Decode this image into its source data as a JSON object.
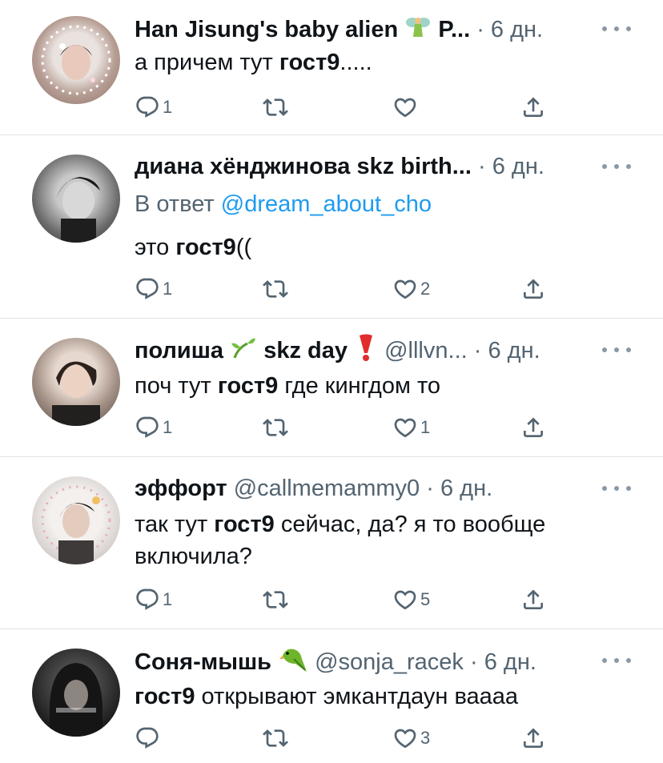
{
  "tweets": [
    {
      "name": "Han Jisung's baby alien",
      "name_suffix": "P...",
      "handle": "",
      "dot": "·",
      "time": "6 дн.",
      "reply_prefix": "",
      "reply_mention": "",
      "text_bold": "гост9",
      "text_pre": "а причем тут ",
      "text_post": ".....",
      "replies": "1",
      "retweets": "",
      "likes": "",
      "avatar_colors": [
        "#d9d2cf",
        "#b9a39a"
      ]
    },
    {
      "name": "диана хёнджинова skz birth...",
      "handle": "",
      "dot": "·",
      "time": "6 дн.",
      "reply_prefix": "В ответ",
      "reply_mention": "@dream_about_cho",
      "text_pre": "это ",
      "text_bold": "гост9",
      "text_post": "((",
      "replies": "1",
      "retweets": "",
      "likes": "2",
      "avatar_colors": [
        "#9a9a9a",
        "#2e2e2e"
      ]
    },
    {
      "name": "полиша",
      "name_mid": "skz day",
      "handle": "@lllvn...",
      "dot": "·",
      "time": "6 дн.",
      "text_pre": "поч тут ",
      "text_bold": "гост9",
      "text_post": " где кингдом то",
      "replies": "1",
      "retweets": "",
      "likes": "1",
      "avatar_colors": [
        "#c7b8ae",
        "#5d4d45"
      ]
    },
    {
      "name": "эффорт",
      "handle": "@callmemammy0",
      "dot": "·",
      "time": "6 дн.",
      "text_pre": "так тут ",
      "text_bold": "гост9",
      "text_post": " сейчас, да? я то вообще включила?",
      "replies": "1",
      "retweets": "",
      "likes": "5",
      "avatar_colors": [
        "#e8e4e0",
        "#6c6a69"
      ]
    },
    {
      "name": "Соня-мышь",
      "handle": "@sonja_racek",
      "dot": "·",
      "time": "6 дн.",
      "text_pre": "",
      "text_bold": "гост9",
      "text_post": " открывают эмкантдаун вааaa",
      "replies": "",
      "retweets": "",
      "likes": "3",
      "avatar_colors": [
        "#3a3a3a",
        "#111111"
      ]
    }
  ],
  "icons": {
    "reply": "reply-icon",
    "retweet": "retweet-icon",
    "like": "heart-icon",
    "share": "share-icon",
    "more": "more-icon"
  },
  "colors": {
    "accent": "#1d9bf0",
    "secondary": "#536471",
    "divider": "#dfe3e6"
  }
}
